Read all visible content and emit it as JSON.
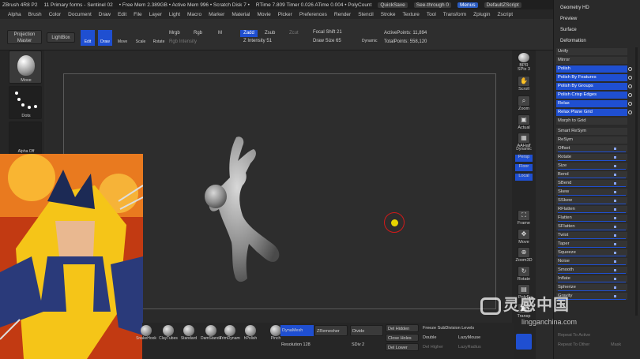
{
  "titlebar": {
    "app": "ZBrush 4R8 P2",
    "doc": "11 Primary forms - Sentinel 02",
    "free_mem": "• Free Mem 2.389GB • Active Mem 996 • Scratch Disk 7 •",
    "timers": "RTime 7.809 Timer 0.026 ATime 0.004 • PolyCount",
    "quicksave": "QuickSave",
    "see_through": "See-through  0",
    "menus": "Menus",
    "default_script": "DefaultZScript"
  },
  "menubar": [
    "Alpha",
    "Brush",
    "Color",
    "Document",
    "Draw",
    "Edit",
    "File",
    "Layer",
    "Light",
    "Macro",
    "Marker",
    "Material",
    "Movie",
    "Picker",
    "Preferences",
    "Render",
    "Stencil",
    "Stroke",
    "Texture",
    "Tool",
    "Transform",
    "Zplugin",
    "Zscript"
  ],
  "toolshelf": {
    "projection_master": "Projection Master",
    "lightbox": "LightBox",
    "edit": "Edit",
    "draw": "Draw",
    "move": "Move",
    "scale": "Scale",
    "rotate": "Rotate",
    "mrgb": "Mrgb",
    "rgb": "Rgb",
    "m": "M",
    "rgb_intensity": "Rgb Intensity",
    "zadd": "Zadd",
    "zsub": "Zsub",
    "zcut": "Zcut",
    "z_intensity": "Z Intensity 51",
    "focal_shift": "Focal Shift 21",
    "draw_size": "Draw Size 65",
    "dynamic": "Dynamic",
    "active_points": "ActivePoints: 11,894",
    "total_points": "TotalPoints: 558,120"
  },
  "leftbar": {
    "brush_label": "Move",
    "stroke_label": "Dots",
    "alpha_label": "Alpha Off"
  },
  "rightshelf": {
    "bpr": "BPR",
    "spix": "SPix 3",
    "scroll": "Scroll",
    "zoom": "Zoom",
    "actual": "Actual",
    "aahalf": "AAHalf",
    "dynamic": "Dynamic",
    "persp": "Persp",
    "floor": "Floor",
    "local": "Local",
    "frame": "Frame",
    "move": "Move",
    "zoom3d": "Zoom3D",
    "rotate": "Rotate",
    "polyf": "PolyF",
    "transp": "Transp"
  },
  "panel": {
    "top_items": [
      "Geometry HD",
      "Preview",
      "Surface",
      "Deformation"
    ],
    "deform_items": [
      {
        "label": "Unify",
        "hl": false
      },
      {
        "label": "Mirror",
        "hl": false
      },
      {
        "label": "Polish",
        "hl": true
      },
      {
        "label": "Polish By Features",
        "hl": true
      },
      {
        "label": "Polish By Groups",
        "hl": true
      },
      {
        "label": "Polish Crisp Edges",
        "hl": true
      },
      {
        "label": "Relax",
        "hl": true
      },
      {
        "label": "Relax Plane Grid",
        "hl": true
      },
      {
        "label": "Morph to Grid",
        "hl": false
      },
      {
        "label": "Smart ReSym",
        "hl": false
      },
      {
        "label": "ReSym",
        "hl": false
      },
      {
        "label": "Offset",
        "hl": false
      },
      {
        "label": "Rotate",
        "hl": false
      },
      {
        "label": "Size",
        "hl": false
      },
      {
        "label": "Bend",
        "hl": false
      },
      {
        "label": "SBend",
        "hl": false
      },
      {
        "label": "Skew",
        "hl": false
      },
      {
        "label": "SSkew",
        "hl": false
      },
      {
        "label": "RFlatten",
        "hl": false
      },
      {
        "label": "Flatten",
        "hl": false
      },
      {
        "label": "SFlatten",
        "hl": false
      },
      {
        "label": "Twist",
        "hl": false
      },
      {
        "label": "Taper",
        "hl": false
      },
      {
        "label": "Squeeze",
        "hl": false
      },
      {
        "label": "Noise",
        "hl": false
      },
      {
        "label": "Smooth",
        "hl": false
      },
      {
        "label": "Inflate",
        "hl": false
      },
      {
        "label": "Spherize",
        "hl": false
      },
      {
        "label": "Gravity",
        "hl": false
      }
    ],
    "footer": {
      "repeat_active": "Repeat To Active",
      "repeat_other": "Repeat To Other",
      "mask": "Mask"
    }
  },
  "bottombar": {
    "brushes": [
      "SnakeHook",
      "ClayTubes",
      "Standard",
      "DamStandard",
      "TrimDynamic",
      "hPolish",
      "Pinch"
    ],
    "dynamesh": "DynaMesh",
    "zremesher": "ZRemesher",
    "divide": "Divide",
    "resolution": "Resolution 128",
    "sdiv": "SDiv 2",
    "del_hidden": "Del Hidden",
    "close_holes": "Close Holes",
    "del_lower": "Del Lower",
    "freeze_subdiv": "Freeze SubDivision Levels",
    "double": "Double",
    "lazymouse": "LazyMouse",
    "del_higher": "Del Higher",
    "lazyradius": "LazyRadius"
  },
  "watermark": {
    "text": "灵感中国",
    "url": "lingganchina.com"
  },
  "colors": {
    "accent": "#1f4fd1",
    "panel_bg": "#2a2a2a",
    "cursor": "#d11a1a",
    "cursor_fill": "#e6d400"
  }
}
